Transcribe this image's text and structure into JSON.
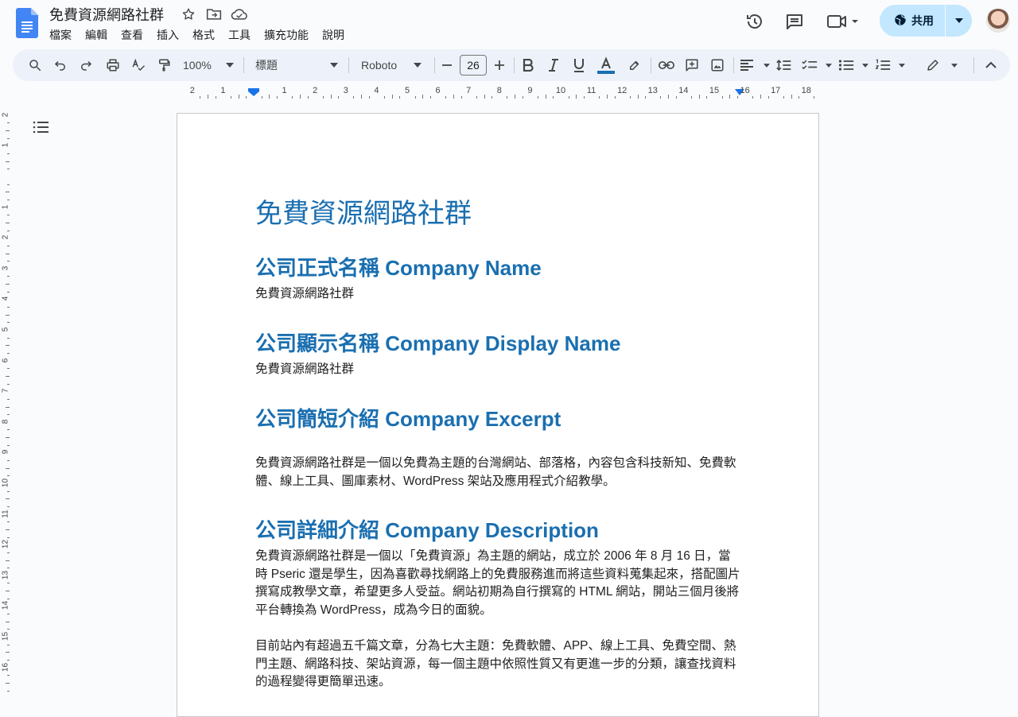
{
  "header": {
    "title": "免費資源網路社群",
    "menu": [
      "檔案",
      "編輯",
      "查看",
      "插入",
      "格式",
      "工具",
      "擴充功能",
      "說明"
    ],
    "share_label": "共用"
  },
  "toolbar": {
    "zoom": "100%",
    "style": "標題",
    "font": "Roboto",
    "font_size": "26"
  },
  "ruler": {
    "labels": [
      "2",
      "1",
      "1",
      "2",
      "3",
      "4",
      "5",
      "6",
      "7",
      "8",
      "9",
      "10",
      "11",
      "12",
      "13",
      "14",
      "15",
      "16",
      "17",
      "18"
    ]
  },
  "vruler": {
    "labels": [
      "2",
      "1",
      "1",
      "2",
      "3",
      "4",
      "5",
      "6",
      "7",
      "8",
      "9",
      "10",
      "11",
      "12",
      "13",
      "14",
      "15",
      "16"
    ]
  },
  "document": {
    "title": "免費資源網路社群",
    "sections": [
      {
        "heading": "公司正式名稱 Company Name",
        "body": "免費資源網路社群"
      },
      {
        "heading": "公司顯示名稱 Company Display Name",
        "body": "免費資源網路社群"
      },
      {
        "heading": "公司簡短介紹 Company Excerpt",
        "body": "免費資源網路社群是一個以免費為主題的台灣網站、部落格，內容包含科技新知、免費軟體、線上工具、圖庫素材、WordPress 架站及應用程式介紹教學。"
      },
      {
        "heading": "公司詳細介紹 Company Description",
        "body": "免費資源網路社群是一個以「免費資源」為主題的網站，成立於 2006 年 8 月 16 日，當時 Pseric 還是學生，因為喜歡尋找網路上的免費服務進而將這些資料蒐集起來，搭配圖片撰寫成教學文章，希望更多人受益。網站初期為自行撰寫的 HTML 網站，開站三個月後將平台轉換為 WordPress，成為今日的面貌。"
      }
    ],
    "extra_paragraph": "目前站內有超過五千篇文章，分為七大主題：免費軟體、APP、線上工具、免費空間、熱門主題、網路科技、架站資源，每一個主題中依照性質又有更進一步的分類，讓查找資料的過程變得更簡單迅速。"
  }
}
